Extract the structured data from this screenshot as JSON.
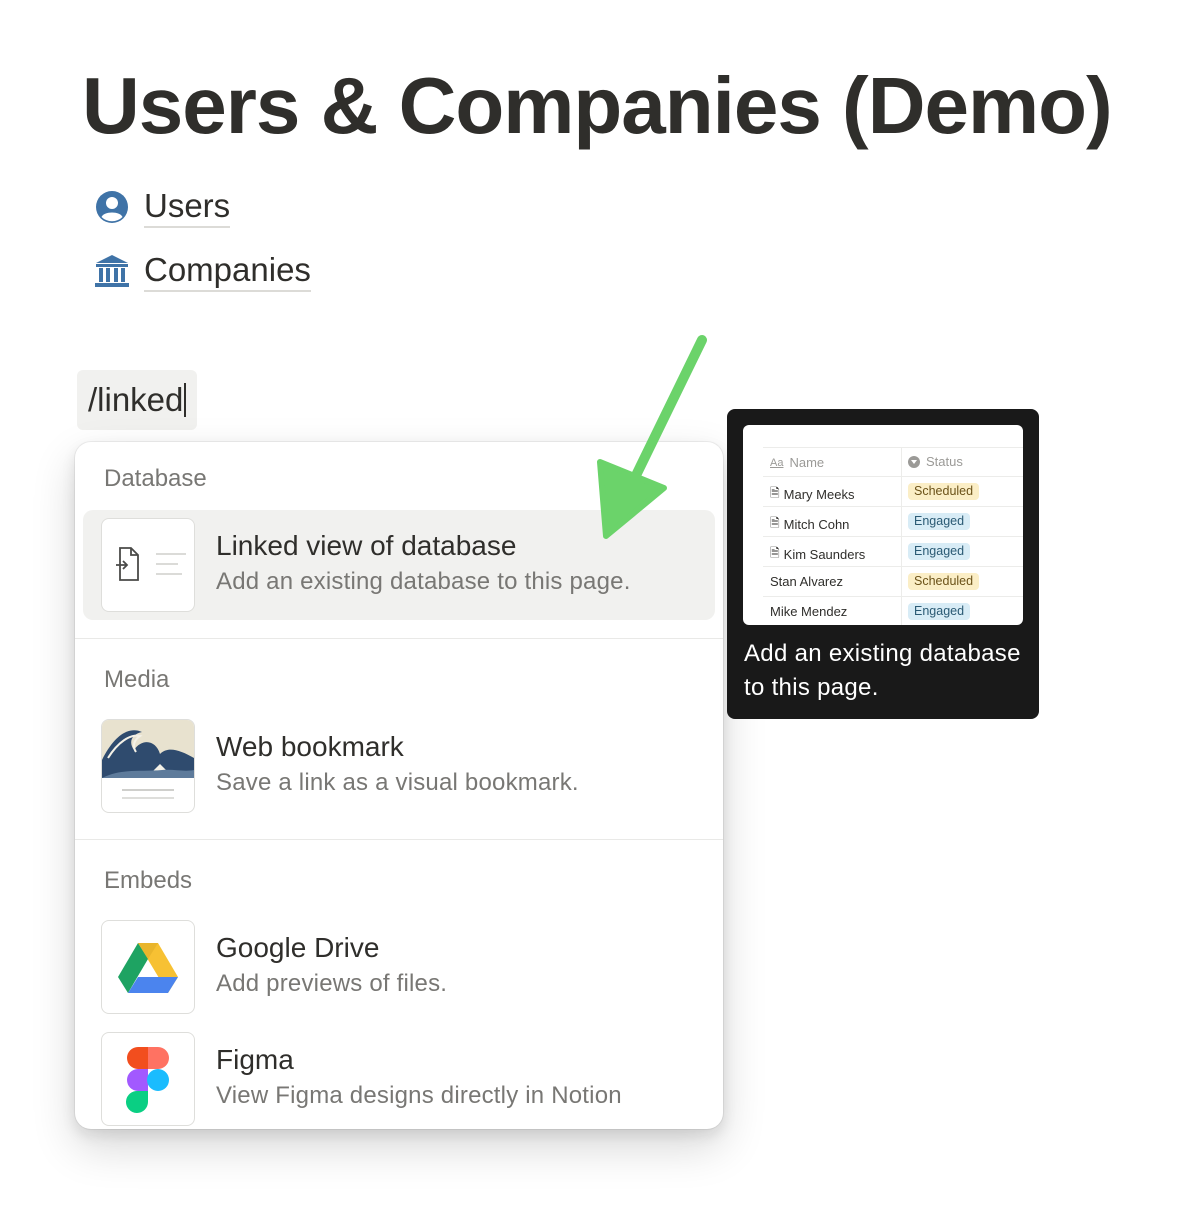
{
  "page": {
    "title": "Users & Companies (Demo)"
  },
  "links": [
    {
      "label": "Users",
      "icon": "user-circle-icon"
    },
    {
      "label": "Companies",
      "icon": "bank-icon"
    }
  ],
  "command": {
    "text": "/linked"
  },
  "menu": {
    "sections": [
      {
        "header": "Database",
        "items": [
          {
            "title": "Linked view of database",
            "desc": "Add an existing database to this page.",
            "icon": "linked-database-icon",
            "selected": true
          }
        ]
      },
      {
        "header": "Media",
        "items": [
          {
            "title": "Web bookmark",
            "desc": "Save a link as a visual bookmark.",
            "icon": "bookmark-thumbnail-icon"
          }
        ]
      },
      {
        "header": "Embeds",
        "items": [
          {
            "title": "Google Drive",
            "desc": "Add previews of files.",
            "icon": "google-drive-icon"
          },
          {
            "title": "Figma",
            "desc": "View Figma designs directly in Notion",
            "icon": "figma-icon"
          }
        ]
      }
    ]
  },
  "tooltip": {
    "preview": {
      "headers": {
        "aa": "Aa",
        "name": "Name",
        "status": "Status"
      },
      "rows": [
        {
          "name": "Mary Meeks",
          "status": "Scheduled",
          "doc": true
        },
        {
          "name": "Mitch Cohn",
          "status": "Engaged",
          "doc": true
        },
        {
          "name": "Kim Saunders",
          "status": "Engaged",
          "doc": true
        },
        {
          "name": "Stan Alvarez",
          "status": "Scheduled",
          "doc": false
        },
        {
          "name": "Mike Mendez",
          "status": "Engaged",
          "doc": false
        }
      ]
    },
    "text": "Add an existing database to this page."
  },
  "colors": {
    "accent": "#4b9d5d",
    "arrow": "#6bd36a",
    "tag_scheduled": "#fbeec6",
    "tag_engaged": "#d8ecf6"
  }
}
